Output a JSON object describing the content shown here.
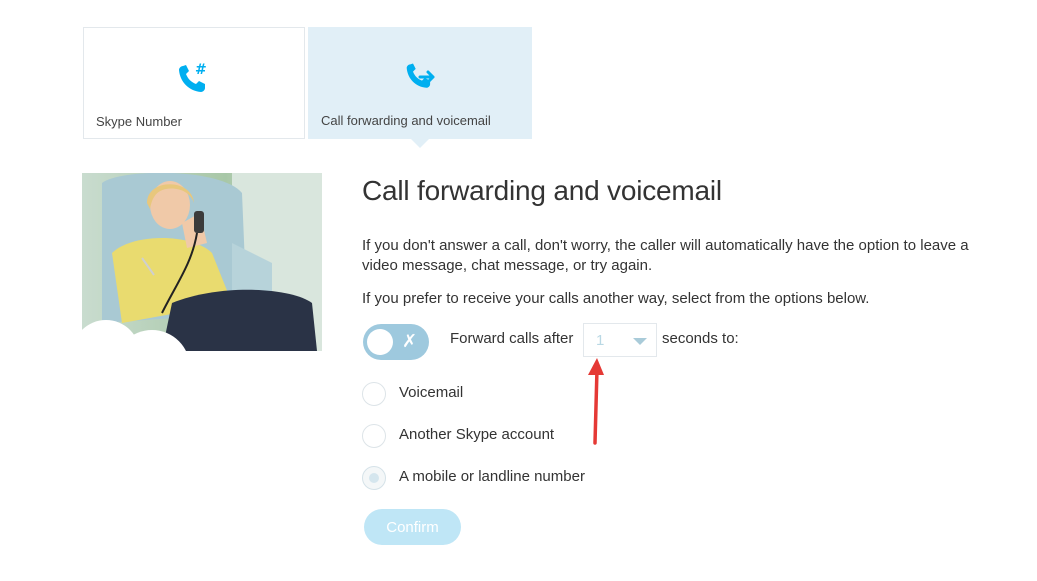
{
  "tabs": [
    {
      "label": "Skype Number",
      "icon": "phone-hash-icon",
      "selected": false
    },
    {
      "label": "Call forwarding and voicemail",
      "icon": "phone-forward-icon",
      "selected": true
    }
  ],
  "content": {
    "title": "Call forwarding and voicemail",
    "para1": "If you don't answer a call, don't worry, the caller will automatically have the option to leave a video message, chat message, or try again.",
    "para2": "If you prefer to receive your calls another way, select from the options below."
  },
  "forward": {
    "toggle_on": false,
    "toggle_icon": "x-icon",
    "label_before": "Forward calls after",
    "seconds_value": "1",
    "label_after": "seconds to:"
  },
  "options": [
    {
      "label": "Voicemail",
      "checked": false
    },
    {
      "label": "Another Skype account",
      "checked": false
    },
    {
      "label": "A mobile or landline number",
      "checked": true
    }
  ],
  "confirm_label": "Confirm",
  "colors": {
    "accent": "#00aff0",
    "tab_selected_bg": "#e1eff7",
    "toggle_bg": "#9ec9de",
    "confirm_bg": "#bfe6f6",
    "annotation_arrow": "#e53935"
  }
}
